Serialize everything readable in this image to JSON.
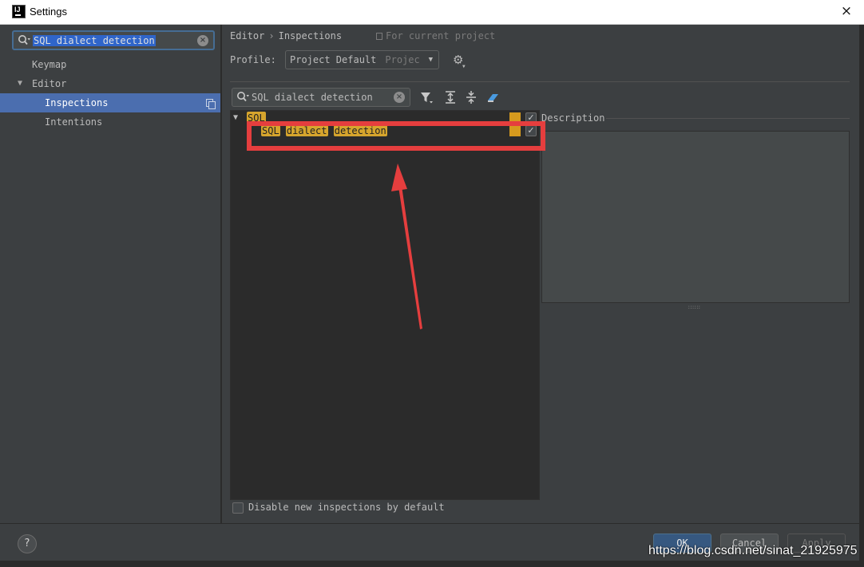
{
  "window": {
    "title": "Settings",
    "app_icon": "intellij-icon",
    "close_icon": "×"
  },
  "left": {
    "search_value": "SQL dialect detection",
    "tree": [
      {
        "label": "Keymap"
      },
      {
        "label": "Editor",
        "expanded": true
      },
      {
        "label": "Inspections",
        "selected": true
      },
      {
        "label": "Intentions"
      }
    ]
  },
  "right": {
    "breadcrumb": {
      "parent": "Editor",
      "separator": "›",
      "current": "Inspections"
    },
    "scope_note": "For current project",
    "profile": {
      "label": "Profile:",
      "value": "Project Default",
      "scope": "Projec"
    },
    "search": {
      "value": "SQL dialect detection"
    },
    "tree": {
      "group": "SQL",
      "item_words": [
        "SQL",
        "dialect",
        "detection"
      ],
      "severity_color": "#d69a1e",
      "group_checked": true,
      "item_checked": true
    },
    "description_label": "Description",
    "disable_new_label": "Disable new inspections by default"
  },
  "buttons": {
    "help": "?",
    "ok": "OK",
    "cancel": "Cancel",
    "apply": "Apply"
  },
  "watermark": "https://blog.csdn.net/sinat_21925975",
  "colors": {
    "annotation_red": "#e53e3e",
    "selection_blue": "#4b6eaf",
    "highlight": "#d6a52d"
  }
}
